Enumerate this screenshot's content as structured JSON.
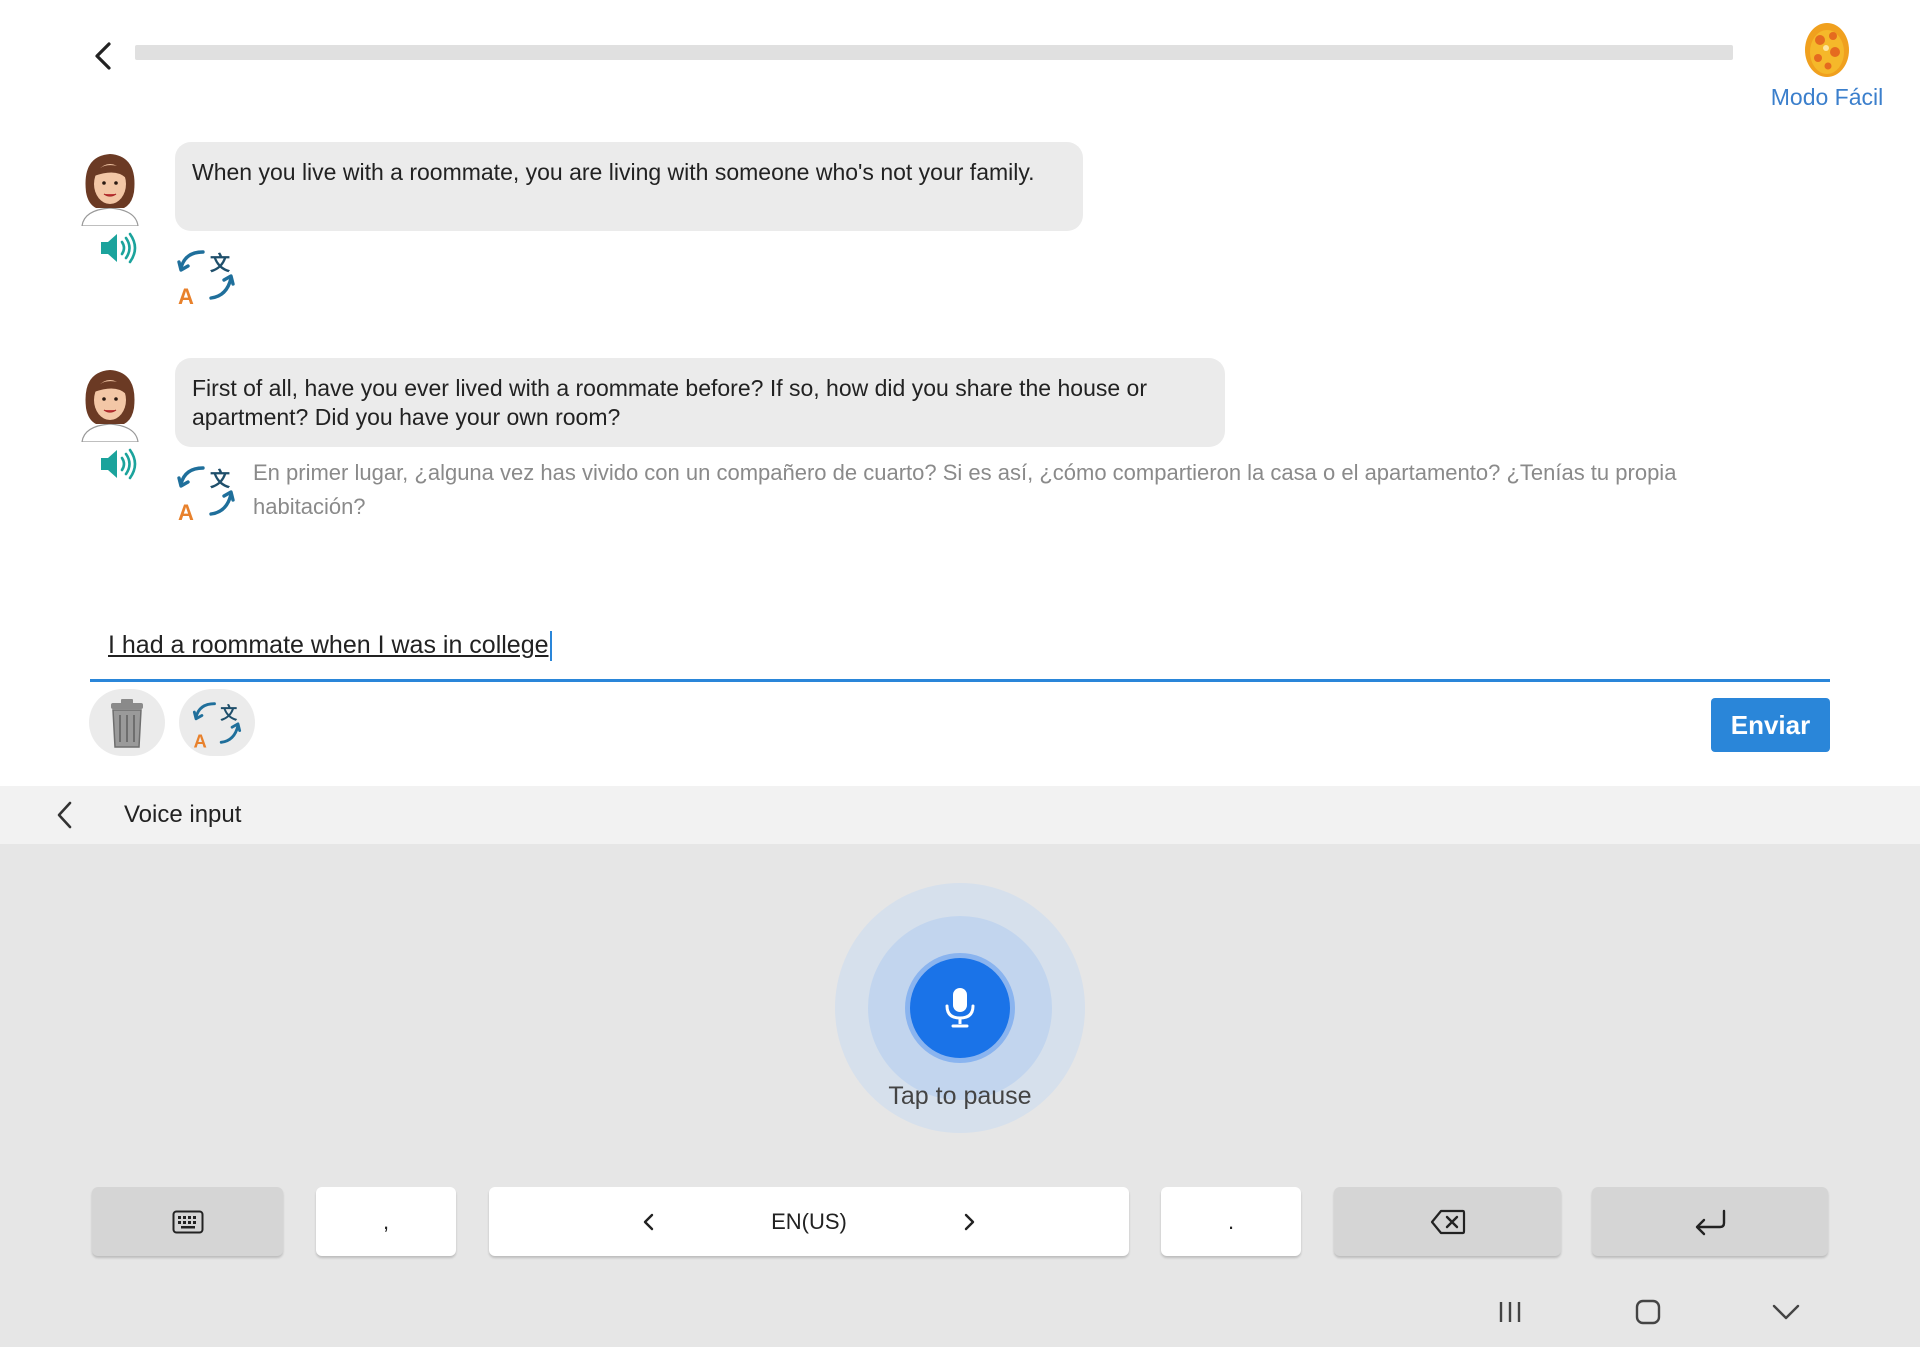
{
  "header": {
    "progress_percent": 0,
    "mode_label": "Modo Fácil"
  },
  "messages": [
    {
      "text": "When you live with a roommate, you are living with someone who's not your family.",
      "translation": ""
    },
    {
      "text": "First of all, have you ever lived with a roommate before? If so, how did you share the house or apartment? Did you have your own room?",
      "translation": "En primer lugar, ¿alguna vez has vivido con un compañero de cuarto? Si es así, ¿cómo compartieron la casa o el apartamento? ¿Tenías tu propia habitación?"
    }
  ],
  "answer": {
    "value": "I had a roommate when I was in college",
    "send_label": "Enviar"
  },
  "voice_input": {
    "title": "Voice input",
    "tap_label": "Tap to pause"
  },
  "keys": {
    "comma": ",",
    "language": "EN(US)",
    "period": "."
  },
  "colors": {
    "accent": "#2a86d9",
    "mic": "#1a73e8",
    "translate_orange": "#e8812c",
    "translate_blue": "#1f6f9b",
    "speaker_teal": "#1ba39c"
  }
}
